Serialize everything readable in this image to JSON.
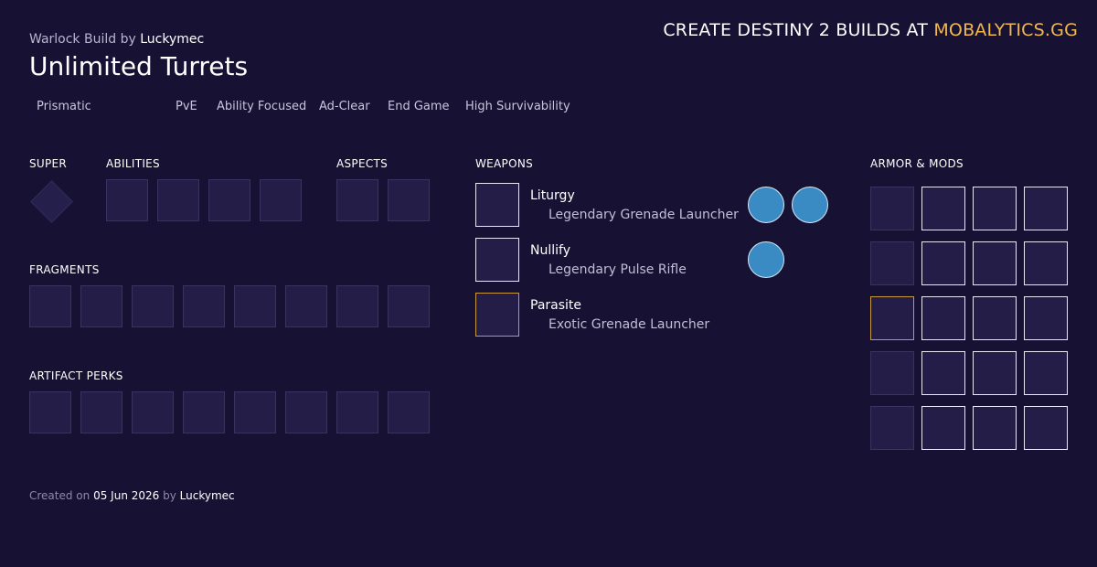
{
  "header": {
    "build_class": "Warlock Build",
    "by_word": "by",
    "author": "Luckymec",
    "title": "Unlimited Turrets",
    "promo_prefix": "CREATE DESTINY 2 BUILDS AT",
    "promo_brand": "MOBALYTICS.GG"
  },
  "tags": [
    "Prismatic",
    "PvE",
    "Ability Focused",
    "Ad-Clear",
    "End Game",
    "High Survivability"
  ],
  "sections": {
    "super": "SUPER",
    "abilities": "ABILITIES",
    "aspects": "ASPECTS",
    "weapons": "WEAPONS",
    "armor": "ARMOR & MODS",
    "fragments": "FRAGMENTS",
    "artifact": "ARTIFACT PERKS"
  },
  "weapons": [
    {
      "name": "Liturgy",
      "type": "Legendary Grenade Launcher",
      "sockets": 2,
      "rarity": "legendary"
    },
    {
      "name": "Nullify",
      "type": "Legendary Pulse Rifle",
      "sockets": 1,
      "rarity": "legendary"
    },
    {
      "name": "Parasite",
      "type": "Exotic Grenade Launcher",
      "sockets": 0,
      "rarity": "exotic"
    }
  ],
  "footer": {
    "prefix": "Created on",
    "date": "05 Jun 2026",
    "by_word": "by",
    "author": "Luckymec"
  },
  "colors": {
    "background": "#171233",
    "brand": "#f0b84d",
    "exotic_border": "#c99a3c",
    "socket": "#3a8bc4"
  }
}
